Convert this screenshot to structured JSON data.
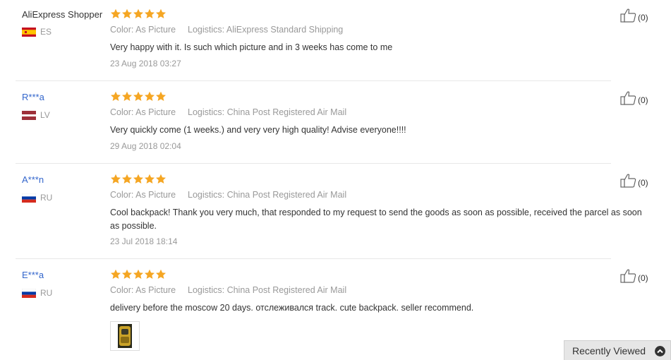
{
  "reviews": [
    {
      "user": "AliExpress Shopper",
      "country": "ES",
      "stars": 5,
      "color": "Color: As Picture",
      "logistics": "Logistics: AliExpress Standard Shipping",
      "text": "Very happy with it. Is such which picture and in 3 weeks has come to me",
      "date": "23 Aug 2018 03:27",
      "likes": "(0)"
    },
    {
      "user": "R***a",
      "country": "LV",
      "stars": 5,
      "color": "Color: As Picture",
      "logistics": "Logistics: China Post Registered Air Mail",
      "text": "Very quickly come (1 weeks.) and very very high quality! Advise everyone!!!!",
      "date": "29 Aug 2018 02:04",
      "likes": "(0)"
    },
    {
      "user": "A***n",
      "country": "RU",
      "stars": 5,
      "color": "Color: As Picture",
      "logistics": "Logistics: China Post Registered Air Mail",
      "text": "Cool backpack! Thank you very much, that responded to my request to send the goods as soon as possible, received the parcel as soon as possible.",
      "date": "23 Jul 2018 18:14",
      "likes": "(0)"
    },
    {
      "user": "E***a",
      "country": "RU",
      "stars": 5,
      "color": "Color: As Picture",
      "logistics": "Logistics: China Post Registered Air Mail",
      "text": "delivery before the moscow 20 days. отслеживался track. cute backpack. seller recommend.",
      "likes": "(0)",
      "photo_icon": "review-photo-thumbnail"
    }
  ],
  "recently_viewed": {
    "label": "Recently Viewed",
    "icon": "chevron-up-icon"
  },
  "colors": {
    "star": "#f5a623",
    "link": "#3366cc",
    "muted": "#999999"
  }
}
